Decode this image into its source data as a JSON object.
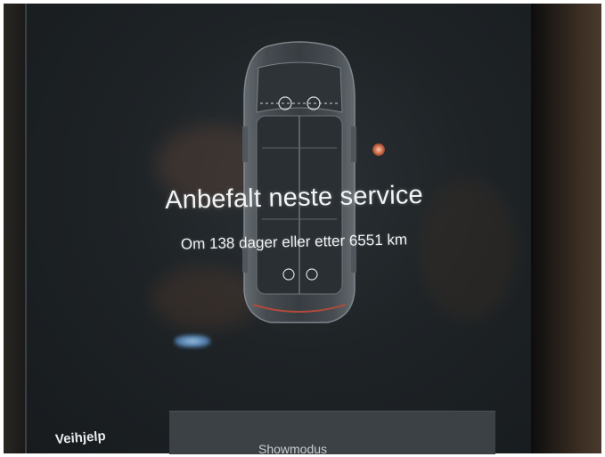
{
  "service": {
    "title": "Anbefalt neste service",
    "detail": "Om 138 dager eller etter 6551 km"
  },
  "footer": {
    "left_label": "Veihjelp",
    "bar_label": "Showmodus"
  },
  "icons": {
    "vehicle": "car-top-view-icon"
  },
  "colors": {
    "screen_background": "#1e2326",
    "text": "#f2f4f5",
    "bottom_bar": "#3b4145"
  }
}
